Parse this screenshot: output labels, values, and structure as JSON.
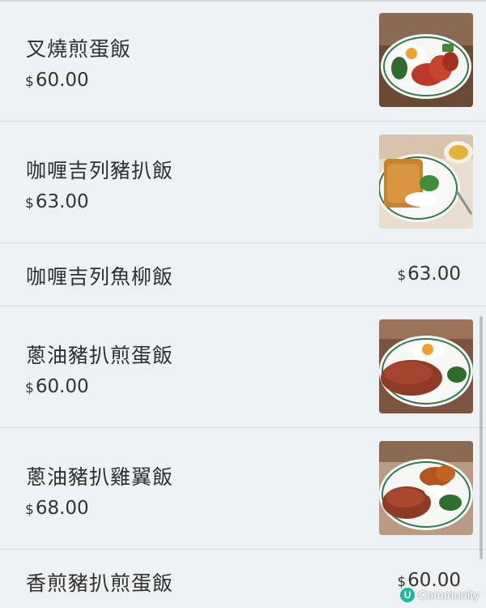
{
  "menu": {
    "currency_symbol": "$",
    "items": [
      {
        "name": "叉燒煎蛋飯",
        "price": "60.00",
        "image": "char-siu-fried-egg-rice-photo"
      },
      {
        "name": "咖喱吉列豬扒飯",
        "price": "63.00",
        "image": "curry-pork-cutlet-rice-photo"
      },
      {
        "name": "咖喱吉列魚柳飯",
        "price": "63.00"
      },
      {
        "name": "蔥油豬扒煎蛋飯",
        "price": "60.00",
        "image": "scallion-pork-chop-fried-egg-rice-photo"
      },
      {
        "name": "蔥油豬扒雞翼飯",
        "price": "68.00",
        "image": "scallion-pork-chop-chicken-wing-rice-photo"
      },
      {
        "name": "香煎豬扒煎蛋飯",
        "price": "60.00"
      }
    ]
  },
  "watermark": {
    "logo_letter": "U",
    "text": "Community"
  },
  "colors": {
    "background": "#eef1f4",
    "divider": "#d3d8dd",
    "text": "#2f2f2f",
    "watermark_brand": "#1eb8a0"
  }
}
